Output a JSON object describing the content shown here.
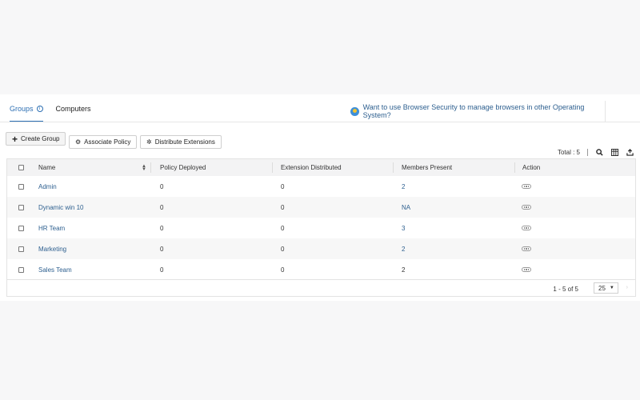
{
  "tabs": [
    {
      "label": "Groups",
      "active": true
    },
    {
      "label": "Computers",
      "active": false
    }
  ],
  "promo": {
    "text": "Want to use Browser Security to manage browsers in other Operating System?"
  },
  "buttons": {
    "create": "Create Group",
    "associate": "Associate Policy",
    "distribute": "Distribute Extensions"
  },
  "toolbar": {
    "total": "Total : 5"
  },
  "table": {
    "headers": [
      "Name",
      "Policy Deployed",
      "Extension Distributed",
      "Members Present",
      "Action"
    ],
    "rows": [
      {
        "name": "Admin",
        "policy": "0",
        "extension": "0",
        "members": "2"
      },
      {
        "name": "Dynamic win 10",
        "policy": "0",
        "extension": "0",
        "members": "NA"
      },
      {
        "name": "HR Team",
        "policy": "0",
        "extension": "0",
        "members": "3"
      },
      {
        "name": "Marketing",
        "policy": "0",
        "extension": "0",
        "members": "2"
      },
      {
        "name": "Sales Team",
        "policy": "0",
        "extension": "0",
        "members": "2"
      }
    ]
  },
  "pagination": {
    "range": "1 - 5 of 5",
    "page_size": "25"
  },
  "colors": {
    "accent": "#2d6fb3",
    "link": "#2d5f8f"
  }
}
